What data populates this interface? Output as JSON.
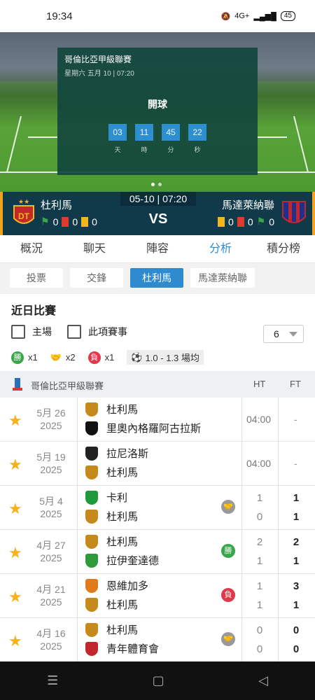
{
  "status": {
    "time": "19:34",
    "signal": "4G+",
    "battery": "45"
  },
  "hero": {
    "league": "哥倫比亞甲級聯賽",
    "date": "星期六 五月 10 | 07:20",
    "kickoff_label": "開球",
    "countdown": [
      {
        "n": "03",
        "l": "天"
      },
      {
        "n": "11",
        "l": "時"
      },
      {
        "n": "45",
        "l": "分"
      },
      {
        "n": "22",
        "l": "秒"
      }
    ]
  },
  "match": {
    "datetime": "05-10 | 07:20",
    "vs": "VS",
    "home": {
      "name": "杜利馬",
      "cards": [
        "0",
        "0",
        "0"
      ],
      "color": "#c1272d"
    },
    "away": {
      "name": "馬達萊納聯",
      "cards": [
        "0",
        "0",
        "0"
      ],
      "color": "#1d2f8f"
    }
  },
  "tabs": [
    "概況",
    "聊天",
    "陣容",
    "分析",
    "積分榜"
  ],
  "active_tab": "分析",
  "subtabs": [
    "投票",
    "交鋒",
    "杜利馬",
    "馬達萊納聯"
  ],
  "active_subtab": "杜利馬",
  "recent": {
    "title": "近日比賽",
    "filter_home": "主場",
    "filter_comp": "此項賽事",
    "count": "6",
    "legend": {
      "win": "勝",
      "win_count": "x1",
      "draw_count": "x2",
      "loss": "負",
      "loss_count": "x1",
      "avg": "1.0 - 1.3 場均"
    }
  },
  "league_header": {
    "name": "哥倫比亞甲級聯賽",
    "ht": "HT",
    "ft": "FT"
  },
  "matches": [
    {
      "month": "5月 26",
      "year": "2025",
      "home": "杜利馬",
      "away": "里奧內格羅阿古拉斯",
      "time": "04:00",
      "ft": "-",
      "bold_home": true
    },
    {
      "month": "5月 19",
      "year": "2025",
      "home": "拉尼洛斯",
      "away": "杜利馬",
      "time": "04:00",
      "ft": "-",
      "bold_home": false
    },
    {
      "month": "5月 4",
      "year": "2025",
      "home": "卡利",
      "away": "杜利馬",
      "result": "draw",
      "ht": [
        "1",
        "0"
      ],
      "ft": [
        "1",
        "1"
      ]
    },
    {
      "month": "4月 27",
      "year": "2025",
      "home": "杜利馬",
      "away": "拉伊奎達德",
      "result": "勝",
      "ht": [
        "2",
        "1"
      ],
      "ft": [
        "2",
        "1"
      ]
    },
    {
      "month": "4月 21",
      "year": "2025",
      "home": "恩維加多",
      "away": "杜利馬",
      "result": "負",
      "ht": [
        "1",
        "1"
      ],
      "ft": [
        "3",
        "1"
      ]
    },
    {
      "month": "4月 16",
      "year": "2025",
      "home": "杜利馬",
      "away": "青年體育會",
      "result": "draw",
      "ht": [
        "0",
        "0"
      ],
      "ft": [
        "0",
        "0"
      ]
    }
  ]
}
